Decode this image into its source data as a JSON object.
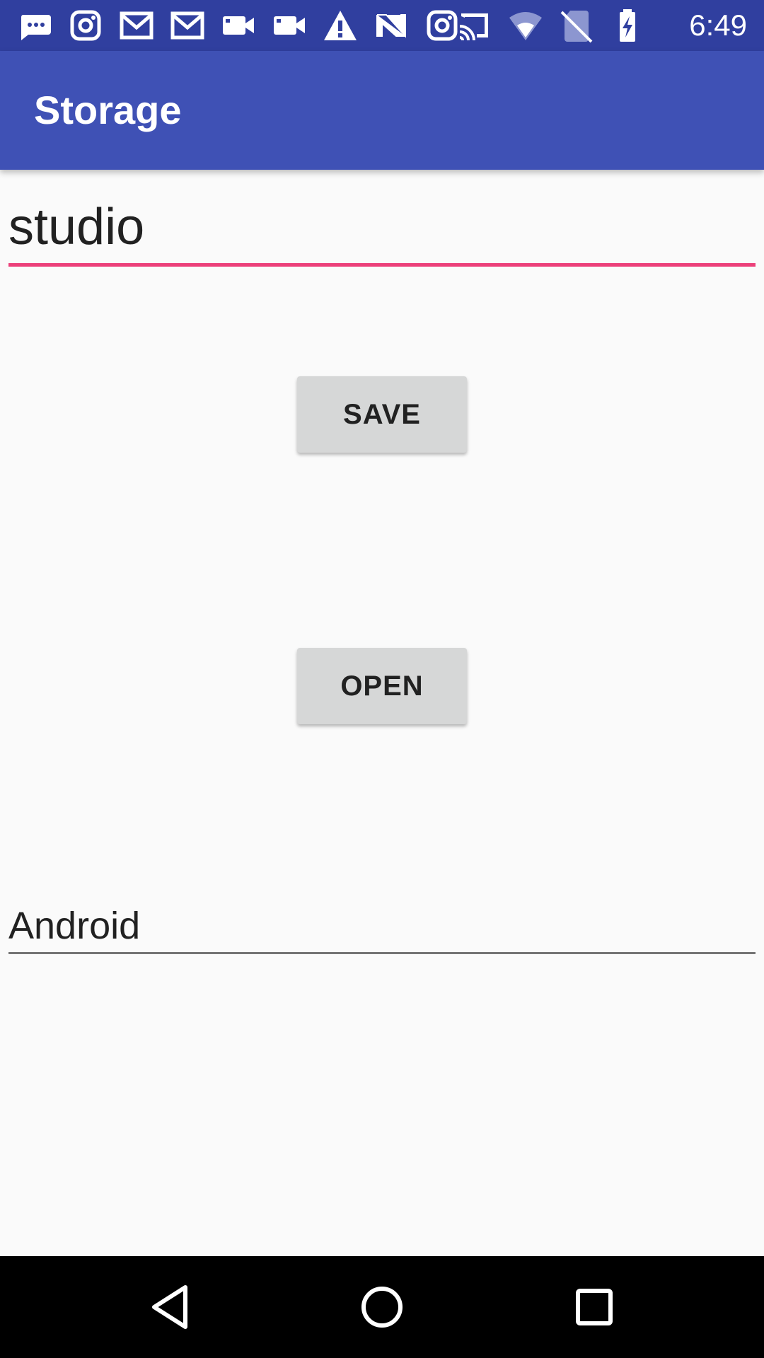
{
  "status_bar": {
    "time": "6:49",
    "left_icons": [
      "messages-icon",
      "instagram-icon",
      "gmail-icon",
      "gmail-icon",
      "video-camera-icon",
      "video-camera-icon",
      "warning-icon",
      "n-logo-icon",
      "instagram-icon"
    ],
    "right_icons": [
      "cast-icon",
      "wifi-icon",
      "no-sim-icon",
      "battery-charging-icon"
    ],
    "color": "#303f9f"
  },
  "app_bar": {
    "title": "Storage",
    "color": "#3f51b5"
  },
  "main": {
    "top_field": {
      "value": "studio",
      "accent_color": "#e91e63"
    },
    "save_button": {
      "label": "SAVE"
    },
    "open_button": {
      "label": "OPEN"
    },
    "bottom_field": {
      "value": "Android"
    }
  },
  "nav_bar": {
    "buttons": [
      "back-icon",
      "home-icon",
      "recents-icon"
    ]
  }
}
